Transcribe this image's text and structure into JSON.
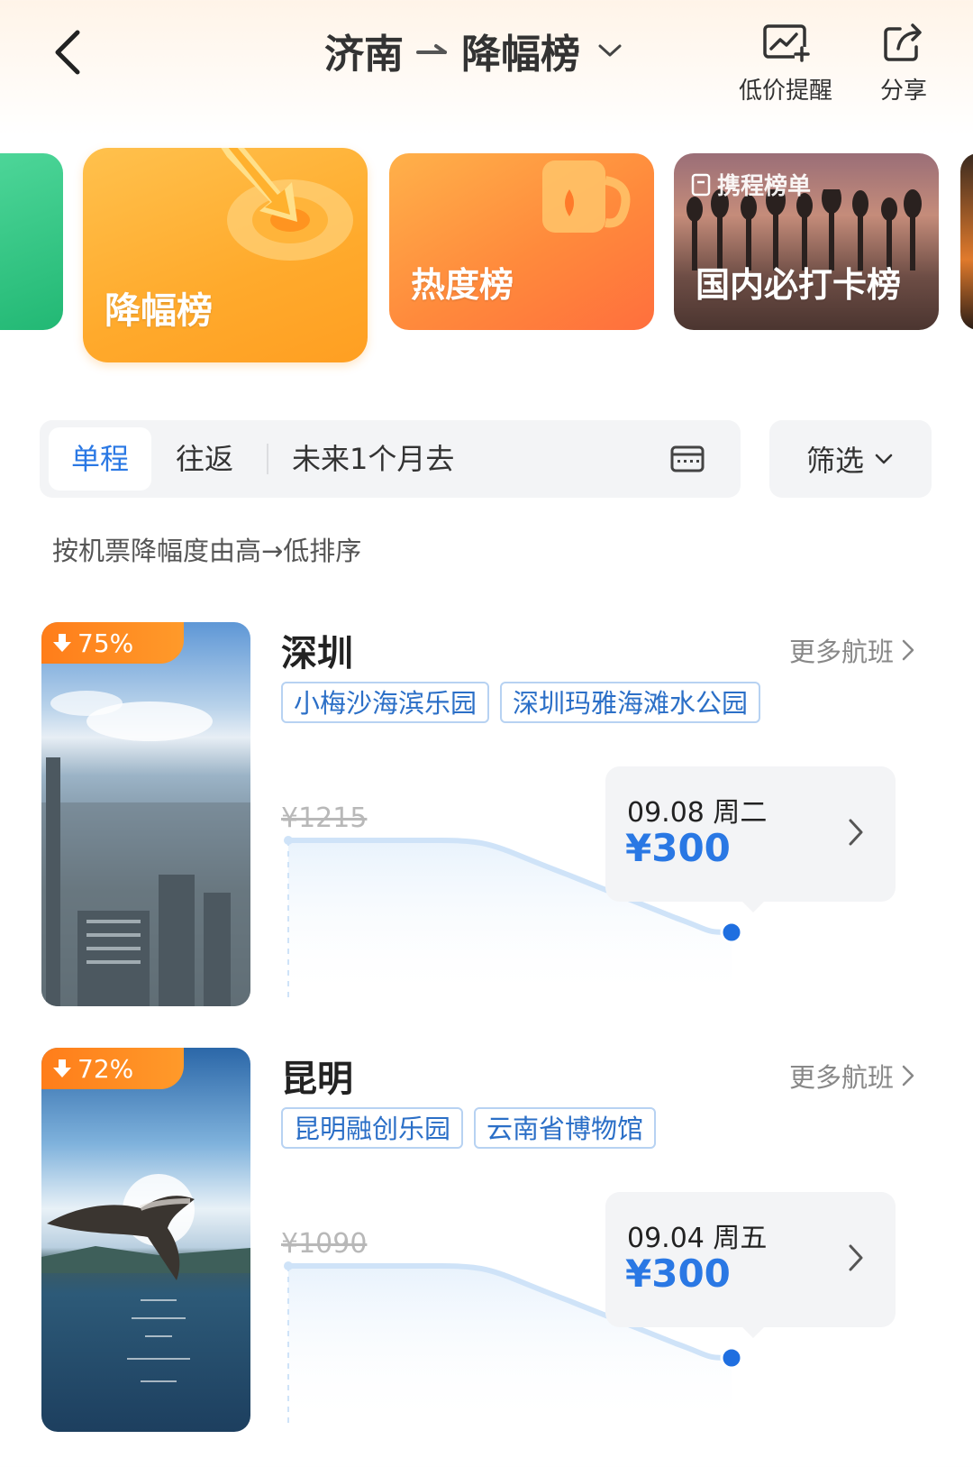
{
  "header": {
    "origin": "济南",
    "rank_title": "降幅榜",
    "actions": [
      {
        "label": "低价提醒",
        "icon": "price-alert-chart-icon"
      },
      {
        "label": "分享",
        "icon": "share-icon"
      }
    ]
  },
  "categories": [
    {
      "label": "降幅榜",
      "selected": true
    },
    {
      "label": "热度榜",
      "selected": false
    },
    {
      "label": "国内必打卡榜",
      "tag": "携程榜单",
      "selected": false
    }
  ],
  "filters": {
    "trip_types": [
      "单程",
      "往返"
    ],
    "selected_trip_type": "单程",
    "date_range": "未来1个月去",
    "filter_label": "筛选"
  },
  "sort_note": "按机票降幅度由高→低排序",
  "colors": {
    "accent_blue": "#2a78e4",
    "badge_orange": "#ff7d1a",
    "line_light_blue": "#cfe3f8"
  },
  "destinations": [
    {
      "city": "深圳",
      "drop_percent": "75%",
      "more_label": "更多航班",
      "tags": [
        "小梅沙海滨乐园",
        "深圳玛雅海滩水公园"
      ],
      "original_price": "¥1215",
      "best_date": "09.08 周二",
      "best_price": "¥300"
    },
    {
      "city": "昆明",
      "drop_percent": "72%",
      "more_label": "更多航班",
      "tags": [
        "昆明融创乐园",
        "云南省博物馆"
      ],
      "original_price": "¥1090",
      "best_date": "09.04 周五",
      "best_price": "¥300"
    }
  ]
}
